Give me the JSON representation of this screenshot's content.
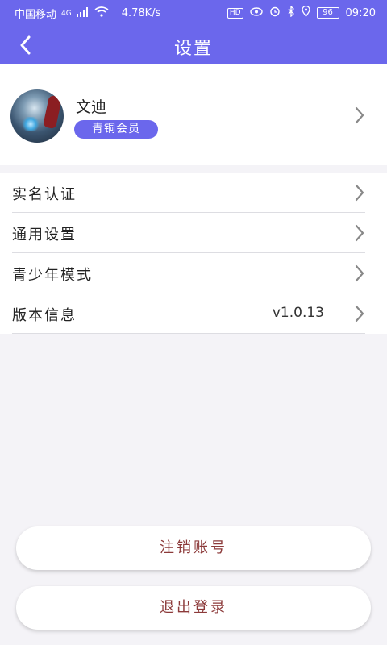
{
  "status_bar": {
    "carrier": "中国移动",
    "network": "4G",
    "speed": "4.78K/s",
    "battery": "96",
    "time": "09:20"
  },
  "header": {
    "title": "设置"
  },
  "profile": {
    "name": "文迪",
    "badge": "青铜会员"
  },
  "settings": {
    "items": [
      {
        "label": "实名认证",
        "value": ""
      },
      {
        "label": "通用设置",
        "value": ""
      },
      {
        "label": "青少年模式",
        "value": ""
      },
      {
        "label": "版本信息",
        "value": "v1.0.13"
      }
    ]
  },
  "buttons": {
    "deactivate": "注销账号",
    "logout": "退出登录"
  },
  "colors": {
    "primary": "#6b67ec",
    "button_text": "#8c3a3a",
    "background": "#f4f3f7"
  }
}
